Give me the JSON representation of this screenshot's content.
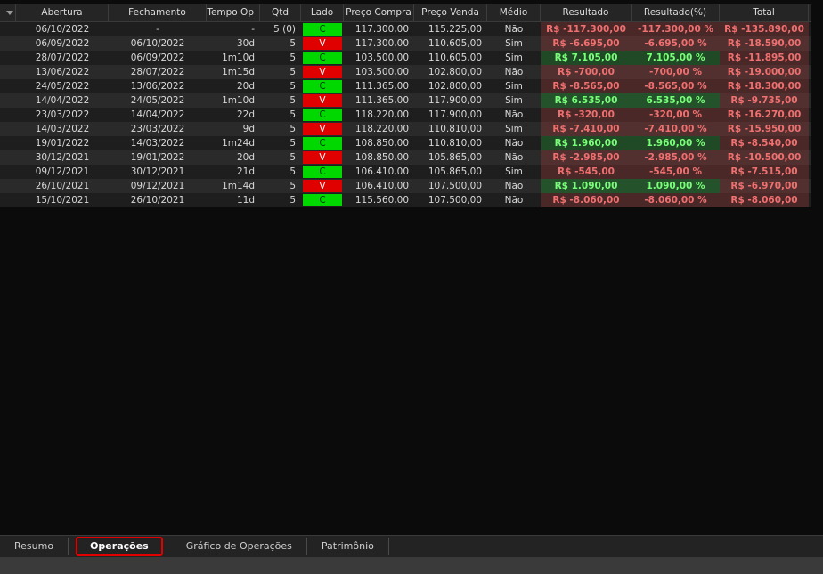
{
  "table": {
    "headers": {
      "abertura": "Abertura",
      "fechamento": "Fechamento",
      "tempo": "Tempo Op",
      "qtd": "Qtd",
      "lado": "Lado",
      "preco_compra": "Preço Compra",
      "preco_venda": "Preço Venda",
      "medio": "Médio",
      "resultado": "Resultado",
      "resultado_pct": "Resultado(%)",
      "total": "Total"
    },
    "rows": [
      {
        "abertura": "06/10/2022",
        "fechamento": "-",
        "tempo": "-",
        "qtd": "5 (0)",
        "lado": "C",
        "preco_compra": "117.300,00",
        "preco_venda": "115.225,00",
        "medio": "Não",
        "resultado": "R$ -117.300,00",
        "resultado_pct": "-117.300,00 %",
        "total": "R$ -135.890,00",
        "sign": "neg"
      },
      {
        "abertura": "06/09/2022",
        "fechamento": "06/10/2022",
        "tempo": "30d",
        "qtd": "5",
        "lado": "V",
        "preco_compra": "117.300,00",
        "preco_venda": "110.605,00",
        "medio": "Sim",
        "resultado": "R$ -6.695,00",
        "resultado_pct": "-6.695,00 %",
        "total": "R$ -18.590,00",
        "sign": "neg"
      },
      {
        "abertura": "28/07/2022",
        "fechamento": "06/09/2022",
        "tempo": "1m10d",
        "qtd": "5",
        "lado": "C",
        "preco_compra": "103.500,00",
        "preco_venda": "110.605,00",
        "medio": "Sim",
        "resultado": "R$ 7.105,00",
        "resultado_pct": "7.105,00 %",
        "total": "R$ -11.895,00",
        "sign": "pos"
      },
      {
        "abertura": "13/06/2022",
        "fechamento": "28/07/2022",
        "tempo": "1m15d",
        "qtd": "5",
        "lado": "V",
        "preco_compra": "103.500,00",
        "preco_venda": "102.800,00",
        "medio": "Não",
        "resultado": "R$ -700,00",
        "resultado_pct": "-700,00 %",
        "total": "R$ -19.000,00",
        "sign": "neg"
      },
      {
        "abertura": "24/05/2022",
        "fechamento": "13/06/2022",
        "tempo": "20d",
        "qtd": "5",
        "lado": "C",
        "preco_compra": "111.365,00",
        "preco_venda": "102.800,00",
        "medio": "Sim",
        "resultado": "R$ -8.565,00",
        "resultado_pct": "-8.565,00 %",
        "total": "R$ -18.300,00",
        "sign": "neg"
      },
      {
        "abertura": "14/04/2022",
        "fechamento": "24/05/2022",
        "tempo": "1m10d",
        "qtd": "5",
        "lado": "V",
        "preco_compra": "111.365,00",
        "preco_venda": "117.900,00",
        "medio": "Sim",
        "resultado": "R$ 6.535,00",
        "resultado_pct": "6.535,00 %",
        "total": "R$ -9.735,00",
        "sign": "pos"
      },
      {
        "abertura": "23/03/2022",
        "fechamento": "14/04/2022",
        "tempo": "22d",
        "qtd": "5",
        "lado": "C",
        "preco_compra": "118.220,00",
        "preco_venda": "117.900,00",
        "medio": "Não",
        "resultado": "R$ -320,00",
        "resultado_pct": "-320,00 %",
        "total": "R$ -16.270,00",
        "sign": "neg"
      },
      {
        "abertura": "14/03/2022",
        "fechamento": "23/03/2022",
        "tempo": "9d",
        "qtd": "5",
        "lado": "V",
        "preco_compra": "118.220,00",
        "preco_venda": "110.810,00",
        "medio": "Sim",
        "resultado": "R$ -7.410,00",
        "resultado_pct": "-7.410,00 %",
        "total": "R$ -15.950,00",
        "sign": "neg"
      },
      {
        "abertura": "19/01/2022",
        "fechamento": "14/03/2022",
        "tempo": "1m24d",
        "qtd": "5",
        "lado": "C",
        "preco_compra": "108.850,00",
        "preco_venda": "110.810,00",
        "medio": "Não",
        "resultado": "R$ 1.960,00",
        "resultado_pct": "1.960,00 %",
        "total": "R$ -8.540,00",
        "sign": "pos"
      },
      {
        "abertura": "30/12/2021",
        "fechamento": "19/01/2022",
        "tempo": "20d",
        "qtd": "5",
        "lado": "V",
        "preco_compra": "108.850,00",
        "preco_venda": "105.865,00",
        "medio": "Não",
        "resultado": "R$ -2.985,00",
        "resultado_pct": "-2.985,00 %",
        "total": "R$ -10.500,00",
        "sign": "neg"
      },
      {
        "abertura": "09/12/2021",
        "fechamento": "30/12/2021",
        "tempo": "21d",
        "qtd": "5",
        "lado": "C",
        "preco_compra": "106.410,00",
        "preco_venda": "105.865,00",
        "medio": "Sim",
        "resultado": "R$ -545,00",
        "resultado_pct": "-545,00 %",
        "total": "R$ -7.515,00",
        "sign": "neg"
      },
      {
        "abertura": "26/10/2021",
        "fechamento": "09/12/2021",
        "tempo": "1m14d",
        "qtd": "5",
        "lado": "V",
        "preco_compra": "106.410,00",
        "preco_venda": "107.500,00",
        "medio": "Não",
        "resultado": "R$ 1.090,00",
        "resultado_pct": "1.090,00 %",
        "total": "R$ -6.970,00",
        "sign": "pos"
      },
      {
        "abertura": "15/10/2021",
        "fechamento": "26/10/2021",
        "tempo": "11d",
        "qtd": "5",
        "lado": "C",
        "preco_compra": "115.560,00",
        "preco_venda": "107.500,00",
        "medio": "Não",
        "resultado": "R$ -8.060,00",
        "resultado_pct": "-8.060,00 %",
        "total": "R$ -8.060,00",
        "sign": "neg"
      }
    ]
  },
  "tabs": [
    {
      "label": "Resumo",
      "active": false
    },
    {
      "label": "Operações",
      "active": true
    },
    {
      "label": "Gráfico de Operações",
      "active": false
    },
    {
      "label": "Patrimônio",
      "active": false
    }
  ],
  "colors": {
    "buy_green": "#00d800",
    "sell_red": "#e00000",
    "positive_text": "#78ff78",
    "negative_text": "#f07070",
    "active_tab_border": "#e00000"
  },
  "icons": {
    "sort": "sort-triangle-icon"
  }
}
